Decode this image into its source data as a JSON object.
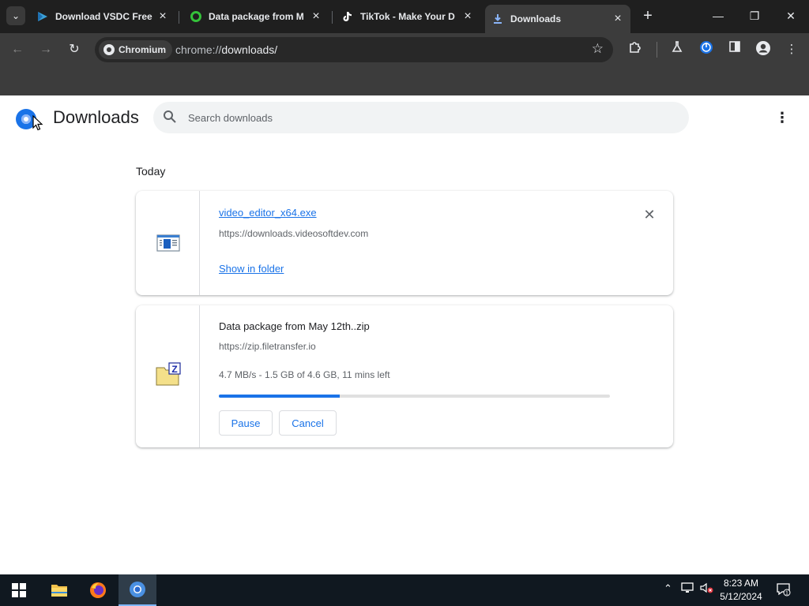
{
  "browser": {
    "tabs": [
      {
        "title": "Download VSDC Free",
        "favicon": "vsdc-icon",
        "active": false
      },
      {
        "title": "Data package from M",
        "favicon": "green-ring-icon",
        "active": false
      },
      {
        "title": "TikTok - Make Your D",
        "favicon": "tiktok-icon",
        "active": false
      },
      {
        "title": "Downloads",
        "favicon": "download-icon",
        "active": true
      }
    ],
    "omnibox": {
      "chip_label": "Chromium",
      "url_prefix": "chrome://",
      "url_path": "downloads/"
    }
  },
  "page": {
    "title": "Downloads",
    "search": {
      "placeholder": "Search downloads",
      "value": ""
    },
    "section_label": "Today",
    "downloads": [
      {
        "filename": "video_editor_x64.exe",
        "source": "https://downloads.videosoftdev.com",
        "action": "Show in folder",
        "icon": "exe-file-icon",
        "state": "complete"
      },
      {
        "filename": "Data package from May 12th..zip",
        "source": "https://zip.filetransfer.io",
        "status": "4.7 MB/s - 1.5 GB of 4.6 GB, 11 mins left",
        "progress": 0.31,
        "pause_label": "Pause",
        "cancel_label": "Cancel",
        "icon": "zip-file-icon",
        "state": "in-progress"
      }
    ]
  },
  "taskbar": {
    "apps": [
      "start-icon",
      "file-explorer-icon",
      "firefox-icon",
      "chromium-icon"
    ],
    "time": "8:23 AM",
    "date": "5/12/2024"
  },
  "colors": {
    "accent": "#1a73e8",
    "tabstrip_bg": "#1f1f1f",
    "toolbar_bg": "#3c3c3c"
  }
}
